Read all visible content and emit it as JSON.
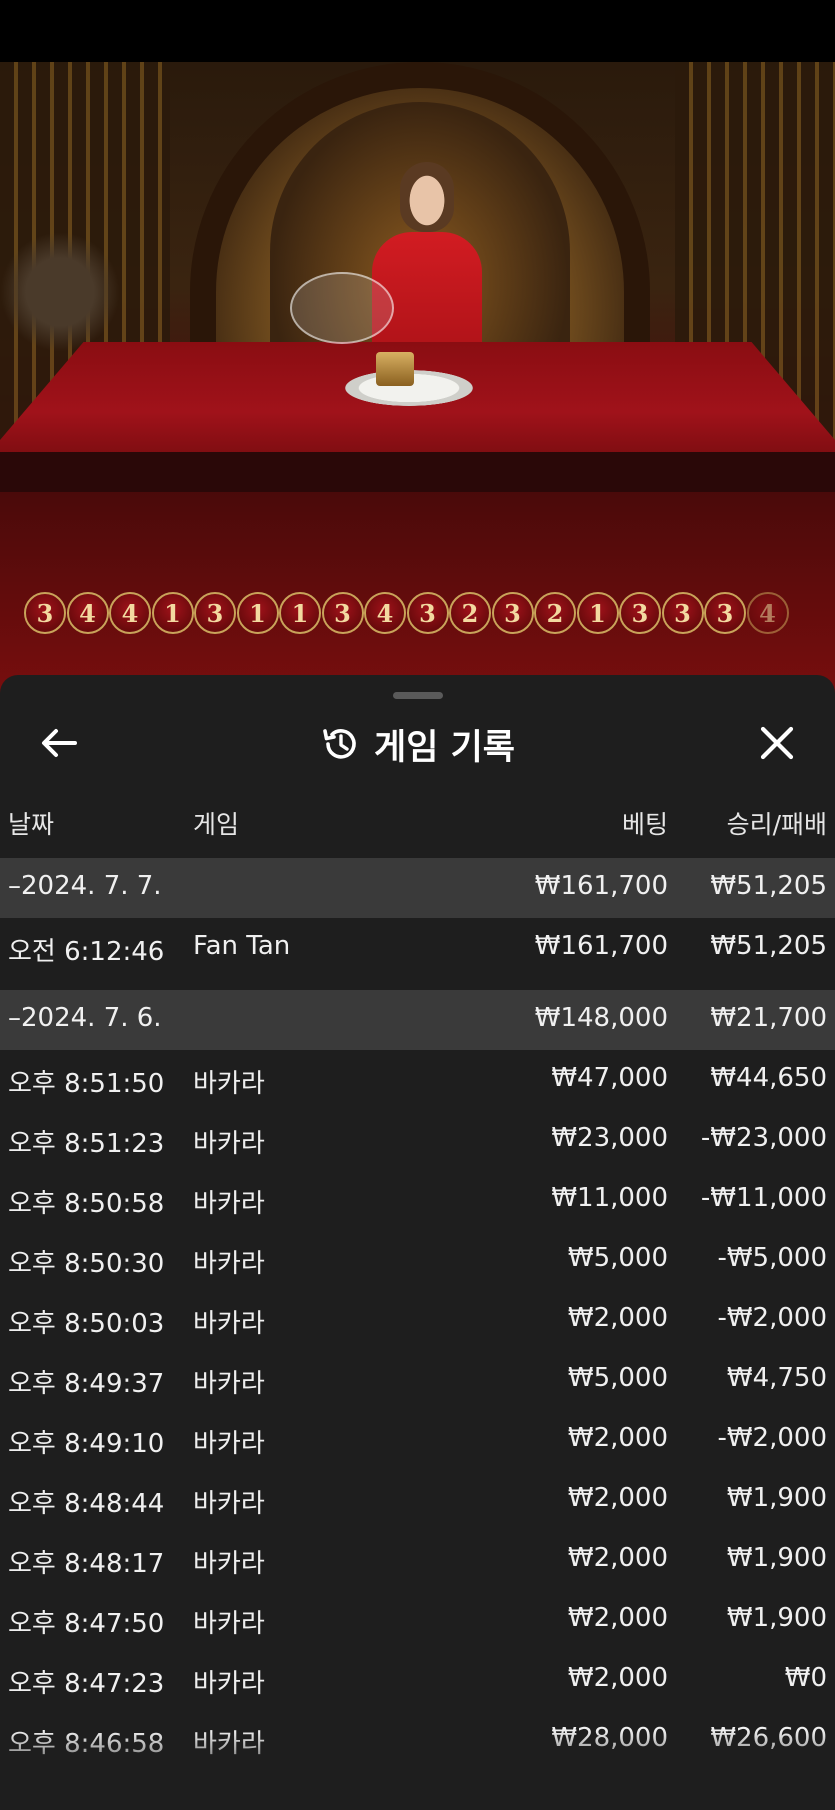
{
  "road": {
    "results": [
      "3",
      "4",
      "4",
      "1",
      "3",
      "1",
      "1",
      "3",
      "4",
      "3",
      "2",
      "3",
      "2",
      "1",
      "3",
      "3",
      "3",
      "4"
    ]
  },
  "sheet": {
    "title": "게임 기록",
    "icons": {
      "back": "arrow-left-icon",
      "history": "history-icon",
      "close": "close-icon"
    }
  },
  "table": {
    "headers": {
      "date": "날짜",
      "game": "게임",
      "bet": "베팅",
      "win": "승리/패배"
    },
    "rows": [
      {
        "type": "group",
        "date": "–2024. 7. 7.",
        "game": "",
        "bet": "₩161,700",
        "win": "₩51,205"
      },
      {
        "type": "item",
        "date": "오전 6:12:46",
        "game": "Fan Tan",
        "bet": "₩161,700",
        "win": "₩51,205"
      },
      {
        "type": "group",
        "date": "–2024. 7. 6.",
        "game": "",
        "bet": "₩148,000",
        "win": "₩21,700"
      },
      {
        "type": "item",
        "date": "오후 8:51:50",
        "game": "바카라",
        "bet": "₩47,000",
        "win": "₩44,650"
      },
      {
        "type": "item",
        "date": "오후 8:51:23",
        "game": "바카라",
        "bet": "₩23,000",
        "win": "-₩23,000"
      },
      {
        "type": "item",
        "date": "오후 8:50:58",
        "game": "바카라",
        "bet": "₩11,000",
        "win": "-₩11,000"
      },
      {
        "type": "item",
        "date": "오후 8:50:30",
        "game": "바카라",
        "bet": "₩5,000",
        "win": "-₩5,000"
      },
      {
        "type": "item",
        "date": "오후 8:50:03",
        "game": "바카라",
        "bet": "₩2,000",
        "win": "-₩2,000"
      },
      {
        "type": "item",
        "date": "오후 8:49:37",
        "game": "바카라",
        "bet": "₩5,000",
        "win": "₩4,750"
      },
      {
        "type": "item",
        "date": "오후 8:49:10",
        "game": "바카라",
        "bet": "₩2,000",
        "win": "-₩2,000"
      },
      {
        "type": "item",
        "date": "오후 8:48:44",
        "game": "바카라",
        "bet": "₩2,000",
        "win": "₩1,900"
      },
      {
        "type": "item",
        "date": "오후 8:48:17",
        "game": "바카라",
        "bet": "₩2,000",
        "win": "₩1,900"
      },
      {
        "type": "item",
        "date": "오후 8:47:50",
        "game": "바카라",
        "bet": "₩2,000",
        "win": "₩1,900"
      },
      {
        "type": "item",
        "date": "오후 8:47:23",
        "game": "바카라",
        "bet": "₩2,000",
        "win": "₩0"
      },
      {
        "type": "item",
        "date": "오후 8:46:58",
        "game": "바카라",
        "bet": "₩28,000",
        "win": "₩26,600"
      }
    ]
  },
  "colors": {
    "sheet_bg": "#1e1e1e",
    "group_row_bg": "#3a3a3a",
    "road_ball": "#a0121a",
    "road_gold": "#c9a35a"
  }
}
